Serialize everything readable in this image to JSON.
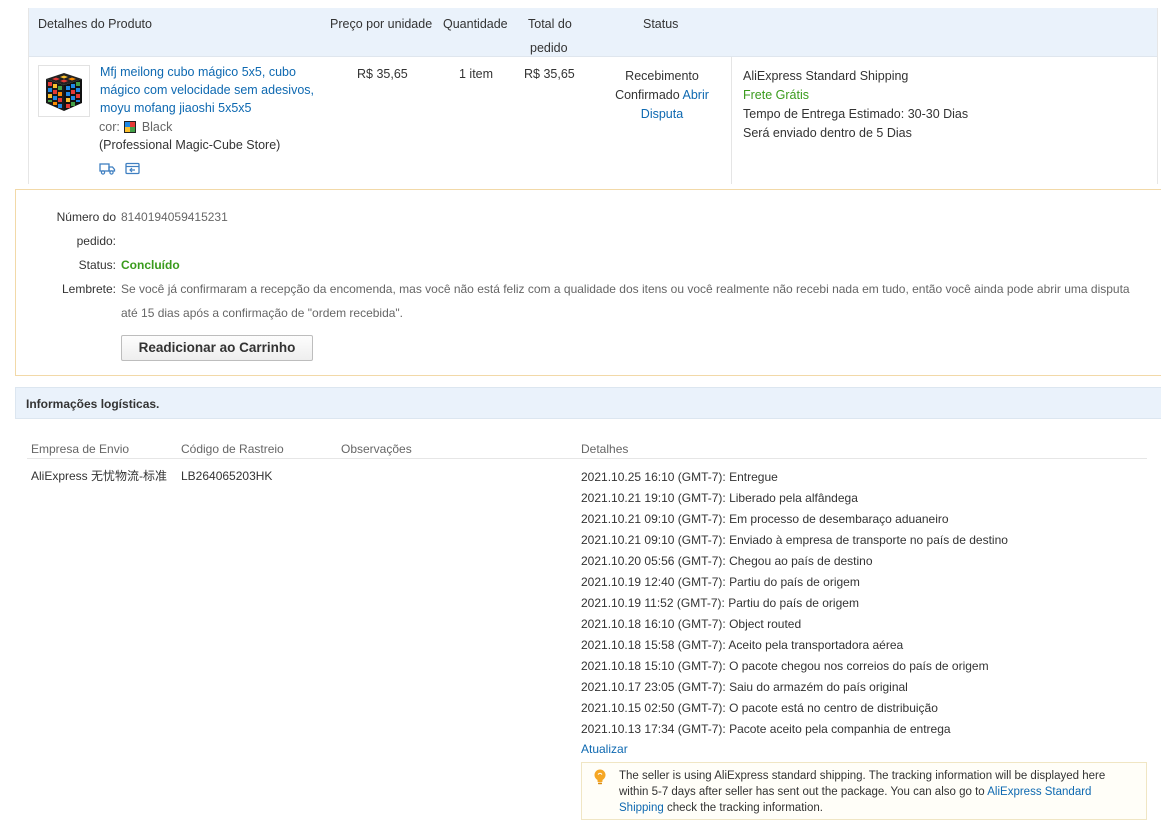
{
  "product_table": {
    "headers": {
      "details": "Detalhes do Produto",
      "unit_price": "Preço por unidade",
      "quantity": "Quantidade",
      "total_line1": "Total do",
      "total_line2": "pedido",
      "status": "Status"
    },
    "item": {
      "title": "Mfj meilong cubo mágico 5x5, cubo mágico com velocidade sem adesivos, moyu mofang jiaoshi 5x5x5",
      "color_label": "cor:",
      "color_value": "Black",
      "store": "(Professional Magic-Cube Store)",
      "price": "R$ 35,65",
      "quantity": "1 item",
      "total": "R$ 35,65",
      "status_line1": "Recebimento",
      "status_line2": "Confirmado",
      "dispute_link_1": "Abrir",
      "dispute_link_2": "Disputa",
      "icons": [
        "truck-icon",
        "return-icon"
      ]
    },
    "shipping": {
      "method": "AliExpress Standard Shipping",
      "free": "Frete Grátis",
      "eta_label": "Tempo de Entrega Estimado:",
      "eta_value": "30-30 Dias",
      "dispatch": "Será enviado dentro de 5 Dias"
    }
  },
  "order_info": {
    "order_number_label_1": "Número do",
    "order_number_label_2": "pedido:",
    "order_number": "8140194059415231",
    "status_label": "Status:",
    "status_value": "Concluído",
    "reminder_label": "Lembrete:",
    "reminder_text": "Se você já confirmaram a recepção da encomenda, mas você não está feliz com a qualidade dos itens ou você realmente não recebi nada em tudo, então você ainda pode abrir uma disputa até 15 dias após a confirmação de \"ordem recebida\".",
    "readd_button": "Readicionar ao Carrinho"
  },
  "logistics": {
    "title": "Informações logísticas.",
    "columns": {
      "carrier": "Empresa de Envio",
      "tracking": "Código de Rastreio",
      "notes": "Observações",
      "details": "Detalhes"
    },
    "carrier": "AliExpress 无忧物流-标准",
    "tracking_code": "LB264065203HK",
    "events": [
      "2021.10.25 16:10 (GMT-7): Entregue",
      "2021.10.21 19:10 (GMT-7): Liberado pela alfândega",
      "2021.10.21 09:10 (GMT-7): Em processo de desembaraço aduaneiro",
      "2021.10.21 09:10 (GMT-7): Enviado à empresa de transporte no país de destino",
      "2021.10.20 05:56 (GMT-7): Chegou ao país de destino",
      "2021.10.19 12:40 (GMT-7): Partiu do país de origem",
      "2021.10.19 11:52 (GMT-7): Partiu do país de origem",
      "2021.10.18 16:10 (GMT-7): Object routed",
      "2021.10.18 15:58 (GMT-7): Aceito pela transportadora aérea",
      "2021.10.18 15:10 (GMT-7): O pacote chegou nos correios do país de origem",
      "2021.10.17 23:05 (GMT-7): Saiu do armazém do país original",
      "2021.10.15 02:50 (GMT-7): O pacote está no centro de distribuição",
      "2021.10.13 17:34 (GMT-7): Pacote aceito pela companhia de entrega"
    ],
    "refresh_link": "Atualizar",
    "notice_text_1": "The seller is using AliExpress standard shipping. The tracking information will be displayed here within 5-7 days after seller has sent out the package. You can also go to",
    "notice_link": "AliExpress Standard Shipping",
    "notice_text_2": "check the tracking information."
  },
  "colors": {
    "link": "#0e69b1",
    "success": "#3a9b1c",
    "header_bg": "#eaf2fb",
    "notice_border": "#f2d9a8"
  }
}
